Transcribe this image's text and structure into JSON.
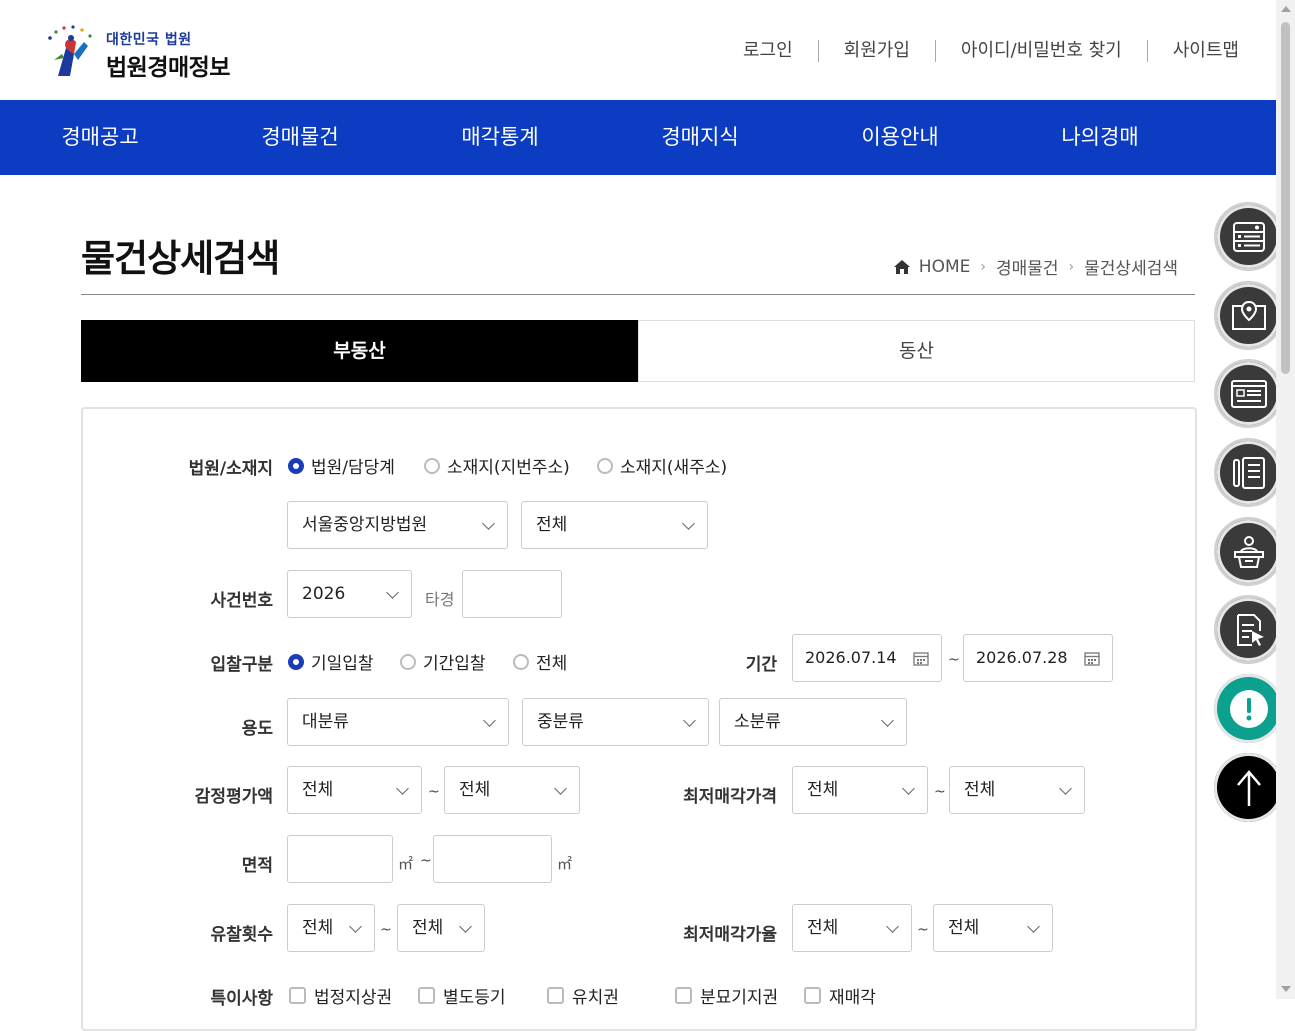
{
  "header": {
    "logo_sub": "대한민국 법원",
    "logo_main": "법원경매정보",
    "util_links": [
      "로그인",
      "회원가입",
      "아이디/비밀번호 찾기",
      "사이트맵"
    ]
  },
  "gnb": [
    "경매공고",
    "경매물건",
    "매각통계",
    "경매지식",
    "이용안내",
    "나의경매"
  ],
  "page": {
    "title": "물건상세검색",
    "breadcrumb": [
      "HOME",
      "경매물건",
      "물건상세검색"
    ]
  },
  "tabs": [
    "부동산",
    "동산"
  ],
  "form": {
    "court_label": "법원/소재지",
    "court_radios": [
      "법원/담당계",
      "소재지(지번주소)",
      "소재지(새주소)"
    ],
    "court_select": "서울중앙지방법원",
    "dept_select": "전체",
    "case_label": "사건번호",
    "case_year": "2026",
    "case_type": "타경",
    "case_number": "",
    "bid_label": "입찰구분",
    "bid_radios": [
      "기일입찰",
      "기간입찰",
      "전체"
    ],
    "period_label": "기간",
    "period_from": "2026.07.14",
    "period_to": "2026.07.28",
    "use_label": "용도",
    "use_major": "대분류",
    "use_middle": "중분류",
    "use_minor": "소분류",
    "appraisal_label": "감정평가액",
    "appraisal_from": "전체",
    "appraisal_to": "전체",
    "minprice_label": "최저매각가격",
    "minprice_from": "전체",
    "minprice_to": "전체",
    "area_label": "면적",
    "area_unit": "㎡",
    "area_from": "",
    "area_to": "",
    "fail_label": "유찰횟수",
    "fail_from": "전체",
    "fail_to": "전체",
    "minrate_label": "최저매각가율",
    "minrate_from": "전체",
    "minrate_to": "전체",
    "special_label": "특이사항",
    "special_checks": [
      "법정지상권",
      "별도등기",
      "유치권",
      "분묘기지권",
      "재매각"
    ],
    "tilde": "~"
  },
  "colors": {
    "brand_blue": "#0b3cc1",
    "radio_blue": "#1a3cb8",
    "teal": "#0ca08e"
  },
  "quick_icons": [
    "server-list-icon",
    "map-pin-icon",
    "notice-board-icon",
    "document-list-icon",
    "auction-judge-icon",
    "document-cursor-icon",
    "alert-icon",
    "arrow-up-icon"
  ]
}
